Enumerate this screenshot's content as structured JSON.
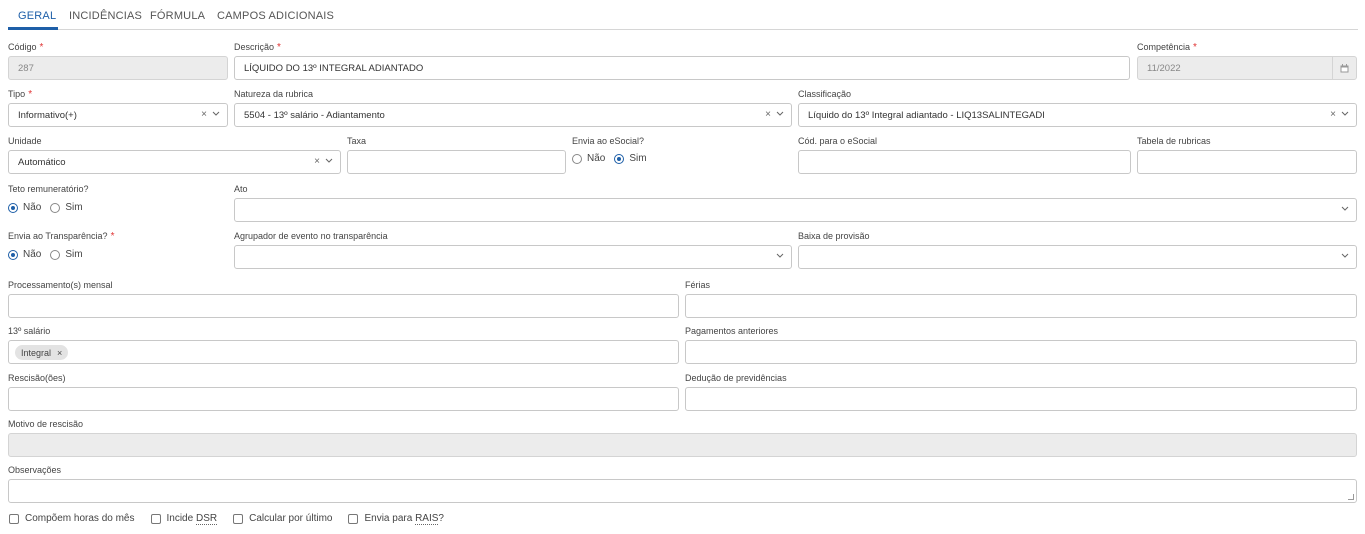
{
  "tabs": [
    "GERAL",
    "INCIDÊNCIAS",
    "FÓRMULA",
    "CAMPOS ADICIONAIS"
  ],
  "fields": {
    "codigo": {
      "label": "Código",
      "value": "287"
    },
    "descricao": {
      "label": "Descrição",
      "value": "LÍQUIDO DO 13º INTEGRAL ADIANTADO"
    },
    "competencia": {
      "label": "Competência",
      "value": "11/2022"
    },
    "tipo": {
      "label": "Tipo",
      "value": "Informativo(+)"
    },
    "natureza": {
      "label": "Natureza da rubrica",
      "value": "5504 - 13º salário - Adiantamento"
    },
    "classificacao": {
      "label": "Classificação",
      "value": "Líquido do 13º Integral adiantado - LIQ13SALINTEGADI"
    },
    "unidade": {
      "label": "Unidade",
      "value": "Automático"
    },
    "taxa": {
      "label": "Taxa",
      "value": ""
    },
    "esocial": {
      "label": "Envia ao eSocial?",
      "options": [
        "Não",
        "Sim"
      ],
      "selected": "Sim"
    },
    "cod_esocial": {
      "label": "Cód. para o eSocial",
      "value": ""
    },
    "tabela": {
      "label": "Tabela de rubricas",
      "value": ""
    },
    "teto": {
      "label": "Teto remuneratório?",
      "options": [
        "Não",
        "Sim"
      ],
      "selected": "Não"
    },
    "ato": {
      "label": "Ato",
      "value": ""
    },
    "transparencia": {
      "label": "Envia ao Transparência?",
      "options": [
        "Não",
        "Sim"
      ],
      "selected": "Não"
    },
    "agrupador": {
      "label": "Agrupador de evento no transparência",
      "value": ""
    },
    "baixa": {
      "label": "Baixa de provisão",
      "value": ""
    },
    "processamento": {
      "label": "Processamento(s) mensal",
      "value": ""
    },
    "ferias": {
      "label": "Férias",
      "value": ""
    },
    "decimo": {
      "label": "13º salário",
      "chips": [
        "Integral"
      ]
    },
    "pagamentos": {
      "label": "Pagamentos anteriores",
      "value": ""
    },
    "rescisao": {
      "label": "Rescisão(ões)",
      "value": ""
    },
    "deducao": {
      "label": "Dedução de previdências",
      "value": ""
    },
    "motivo": {
      "label": "Motivo de rescisão",
      "value": ""
    },
    "observacoes": {
      "label": "Observações",
      "value": ""
    }
  },
  "checkboxes": {
    "horas": {
      "pre": "Compõem horas do mês",
      "abbr": ""
    },
    "dsr": {
      "pre": "Incide ",
      "abbr": "DSR"
    },
    "ultimo": {
      "pre": "Calcular por último",
      "abbr": ""
    },
    "rais": {
      "pre": "Envia para ",
      "abbr": "RAIS",
      "post": "?"
    }
  },
  "icons": {
    "clear": "×",
    "chevron": "chevron-down-icon",
    "calendar": "calendar-icon",
    "chip_remove": "×"
  },
  "colors": {
    "accent": "#1e5fa8",
    "required": "#e03434"
  }
}
